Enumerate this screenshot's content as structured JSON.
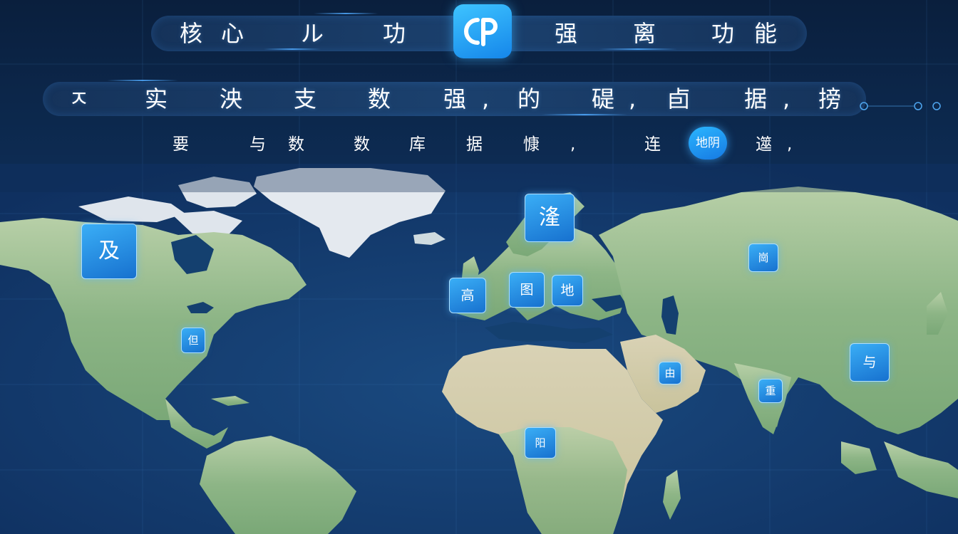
{
  "banner_top": {
    "left_chars": [
      "核",
      "心",
      "ル",
      "功"
    ],
    "right_chars": [
      "强",
      "离",
      "功",
      "能"
    ]
  },
  "banner_second": {
    "chars": [
      "ㅈ",
      "实",
      "泱",
      "支",
      "数",
      "强",
      "的",
      "碮",
      "卣",
      "据",
      "搒"
    ],
    "commas": [
      ",",
      ",",
      ","
    ]
  },
  "subtitle": {
    "chars": [
      "要",
      "与",
      "数",
      "数",
      "库",
      "据",
      "慷",
      ",",
      "连",
      "遾",
      ","
    ],
    "pill_label": "地阴"
  },
  "markers": {
    "north_america_big": "及",
    "north_america_small": "但",
    "scandinavia": "湰",
    "western_europe": "高",
    "central_europe": "图",
    "eastern_europe": "地",
    "russia": "崗",
    "arabia": "由",
    "india": "重",
    "china": "与",
    "africa": "阳"
  },
  "colors": {
    "background": "#0b2445",
    "ocean": "#123a6b",
    "land": "#8fb88a",
    "ice": "#e6ebf1",
    "marker": "#2a93e6",
    "logo": "#2aa8f8"
  }
}
